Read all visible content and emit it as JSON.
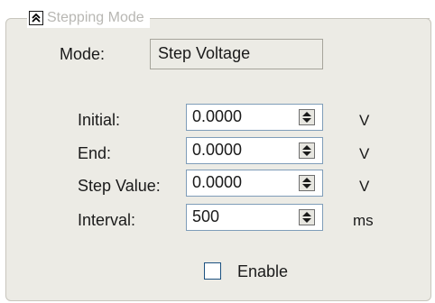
{
  "group": {
    "title": "Stepping Mode",
    "collapse_icon": "double-chevron-up-icon"
  },
  "mode": {
    "label": "Mode:",
    "value": "Step Voltage"
  },
  "fields": [
    {
      "label": "Initial:",
      "value": "0.0000",
      "unit": "V"
    },
    {
      "label": "End:",
      "value": "0.0000",
      "unit": "V"
    },
    {
      "label": "Step Value:",
      "value": "0.0000",
      "unit": "V"
    },
    {
      "label": "Interval:",
      "value": "500",
      "unit": "ms"
    }
  ],
  "enable": {
    "label": "Enable",
    "checked": false
  },
  "colors": {
    "panel_bg": "#ecebe5",
    "disabled_text": "#b8b7b3",
    "field_border": "#7f9db9"
  }
}
